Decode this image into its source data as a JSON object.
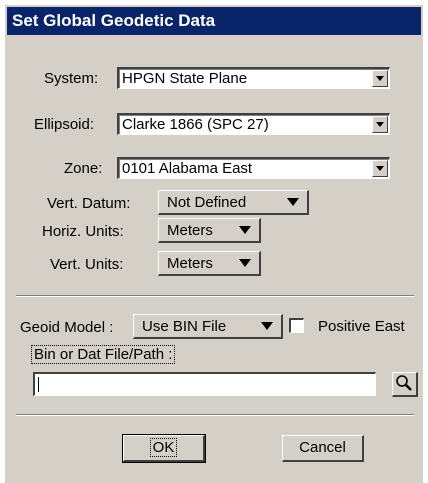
{
  "dialog": {
    "title": "Set Global Geodetic Data",
    "system": {
      "label": "System:",
      "value": "HPGN State Plane"
    },
    "ellipsoid": {
      "label": "Ellipsoid:",
      "value": "Clarke 1866 (SPC 27)"
    },
    "zone": {
      "label": "Zone:",
      "value": "0101 Alabama East"
    },
    "vert_datum": {
      "label": "Vert. Datum:",
      "value": "Not Defined"
    },
    "horiz_units": {
      "label": "Horiz. Units:",
      "value": "Meters"
    },
    "vert_units": {
      "label": "Vert. Units:",
      "value": "Meters"
    },
    "geoid_model": {
      "label": "Geoid Model :",
      "value": "Use BIN File"
    },
    "positive_east": {
      "label": "Positive East",
      "checked": false
    },
    "bin_path": {
      "label": "Bin or Dat File/Path :",
      "value": ""
    },
    "buttons": {
      "ok": "OK",
      "cancel": "Cancel"
    }
  },
  "icons": {
    "dropdown": "chevron-down-icon",
    "browse": "magnifier-icon"
  }
}
